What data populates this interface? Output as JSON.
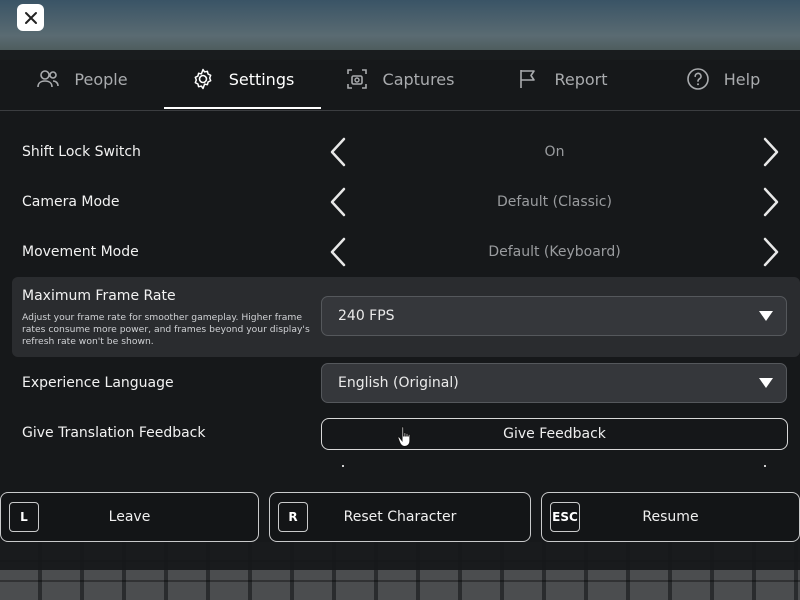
{
  "close": {
    "icon": "close-icon"
  },
  "tabs": [
    {
      "label": "People",
      "icon": "people-icon"
    },
    {
      "label": "Settings",
      "icon": "gear-icon"
    },
    {
      "label": "Captures",
      "icon": "camera-icon"
    },
    {
      "label": "Report",
      "icon": "flag-icon"
    },
    {
      "label": "Help",
      "icon": "help-icon"
    }
  ],
  "settings": {
    "shift_lock": {
      "label": "Shift Lock Switch",
      "value": "On"
    },
    "camera_mode": {
      "label": "Camera Mode",
      "value": "Default (Classic)"
    },
    "movement_mode": {
      "label": "Movement Mode",
      "value": "Default (Keyboard)"
    },
    "max_frame_rate": {
      "label": "Maximum Frame Rate",
      "description": "Adjust your frame rate for smoother gameplay. Higher frame rates consume more power, and frames beyond your display's refresh rate won't be shown.",
      "value": "240 FPS"
    },
    "experience_language": {
      "label": "Experience Language",
      "value": "English (Original)"
    },
    "translation_feedback": {
      "label": "Give Translation Feedback",
      "button": "Give Feedback"
    }
  },
  "bottom": {
    "leave": {
      "key": "L",
      "label": "Leave"
    },
    "reset": {
      "key": "R",
      "label": "Reset Character"
    },
    "resume": {
      "key": "ESC",
      "label": "Resume"
    }
  },
  "colors": {
    "panel": "#16181a",
    "text": "#f0f0f0",
    "muted": "#9a9c9f",
    "dropdown": "#35373b"
  }
}
